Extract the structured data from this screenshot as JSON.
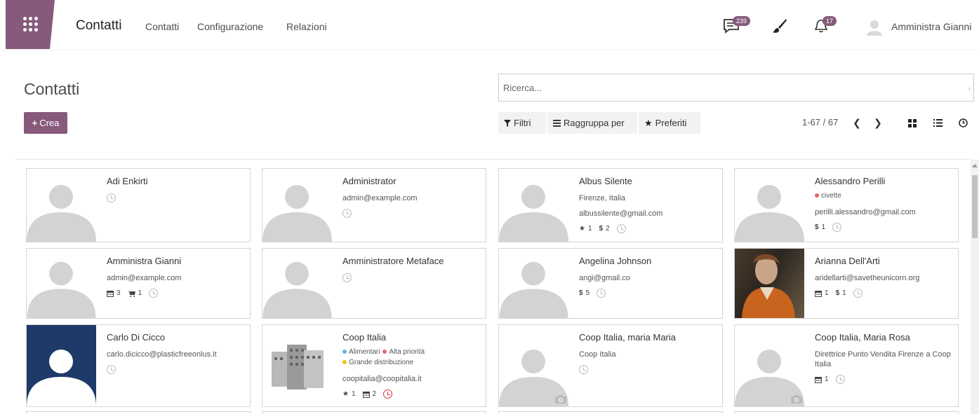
{
  "navbar": {
    "app_name": "Contatti",
    "menu": [
      "Contatti",
      "Configurazione",
      "Relazioni"
    ],
    "messages_count": "239",
    "activities_count": "17",
    "user_name": "Amministra Gianni"
  },
  "control_panel": {
    "title": "Contatti",
    "create_label": "Crea",
    "search_placeholder": "Ricerca...",
    "filters_label": "Filtri",
    "groupby_label": "Raggruppa per",
    "favorites_label": "Preferiti",
    "pager": "1-67 / 67"
  },
  "colors": {
    "brand": "#875a7b",
    "tag_red": "#e06b6b",
    "tag_blue": "#5bb8e8",
    "tag_yellow": "#f0c419",
    "activity_overdue": "#d9333f"
  },
  "cards": [
    {
      "name": "Adi Enkirti",
      "lines": [],
      "tags": [],
      "stats": [],
      "image": "placeholder"
    },
    {
      "name": "Administrator",
      "lines": [
        "admin@example.com"
      ],
      "tags": [],
      "stats": [],
      "image": "placeholder"
    },
    {
      "name": "Albus Silente",
      "lines": [
        "Firenze, Italia",
        "albussilente@gmail.com"
      ],
      "tags": [],
      "stats": [
        {
          "icon": "star-icon",
          "value": "1"
        },
        {
          "icon": "dollar-icon",
          "value": "2"
        }
      ],
      "image": "placeholder"
    },
    {
      "name": "Alessandro Perilli",
      "lines": [
        "perilli.alessandro@gmail.com"
      ],
      "tags": [
        {
          "label": "civette",
          "color": "#e06b6b"
        }
      ],
      "stats": [
        {
          "icon": "dollar-icon",
          "value": "1"
        }
      ],
      "image": "placeholder"
    },
    {
      "name": "Amministra Gianni",
      "lines": [
        "admin@example.com"
      ],
      "tags": [],
      "stats": [
        {
          "icon": "calendar-icon",
          "value": "3"
        },
        {
          "icon": "cart-icon",
          "value": "1"
        }
      ],
      "image": "placeholder"
    },
    {
      "name": "Amministratore Metaface",
      "lines": [],
      "tags": [],
      "stats": [],
      "image": "placeholder"
    },
    {
      "name": "Angelina Johnson",
      "lines": [
        "angi@gmail.co"
      ],
      "tags": [],
      "stats": [
        {
          "icon": "dollar-icon",
          "value": "5"
        }
      ],
      "image": "placeholder"
    },
    {
      "name": "Arianna Dell'Arti",
      "lines": [
        "aridellarti@savetheunicorn.org"
      ],
      "tags": [],
      "stats": [
        {
          "icon": "calendar-icon",
          "value": "1"
        },
        {
          "icon": "dollar-icon",
          "value": "1"
        }
      ],
      "image": "photo"
    },
    {
      "name": "Carlo Di Cicco",
      "lines": [
        "carlo.dicicco@plasticfreeonlus.it"
      ],
      "tags": [],
      "stats": [],
      "image": "blue-silhouette"
    },
    {
      "name": "Coop Italia",
      "lines": [
        "coopitalia@coopitalia.it"
      ],
      "tags": [
        {
          "label": "Alimentari",
          "color": "#5bb8e8"
        },
        {
          "label": "Alta priorità",
          "color": "#e06b6b"
        },
        {
          "label": "Grande distribuzione",
          "color": "#f0c419"
        }
      ],
      "stats": [
        {
          "icon": "star-icon",
          "value": "1"
        },
        {
          "icon": "calendar-icon",
          "value": "2"
        }
      ],
      "image": "buildings",
      "overdue": true
    },
    {
      "name": "Coop Italia, maria Maria",
      "lines": [
        "Coop Italia"
      ],
      "tags": [],
      "stats": [],
      "image": "placeholder-camera"
    },
    {
      "name": "Coop Italia, Maria Rosa",
      "lines": [
        "Direttrice Punto Vendita Firenze a Coop Italia"
      ],
      "tags": [],
      "stats": [
        {
          "icon": "calendar-icon",
          "value": "1"
        }
      ],
      "image": "placeholder-camera"
    }
  ]
}
